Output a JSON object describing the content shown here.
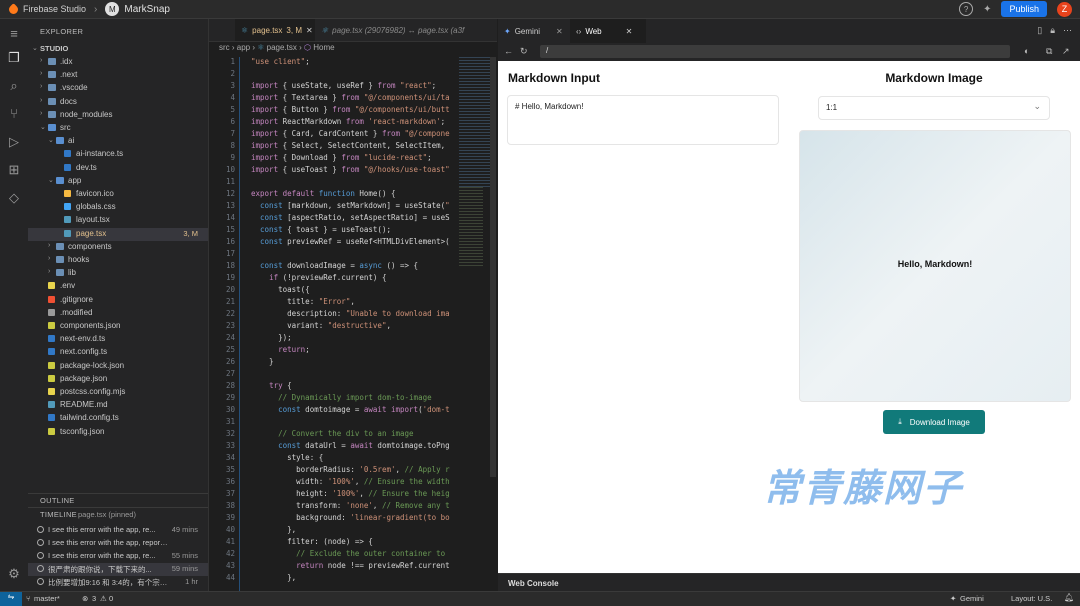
{
  "topbar": {
    "brand": "Firebase Studio",
    "project_initial": "M",
    "project": "MarkSnap",
    "publish": "Publish",
    "avatar": "Z"
  },
  "explorer": {
    "title": "EXPLORER",
    "root": "STUDIO",
    "items": [
      {
        "label": ".idx",
        "type": "folder",
        "depth": 1
      },
      {
        "label": ".next",
        "type": "folder",
        "depth": 1
      },
      {
        "label": ".vscode",
        "type": "folder",
        "depth": 1
      },
      {
        "label": "docs",
        "type": "folder",
        "depth": 1
      },
      {
        "label": "node_modules",
        "type": "folder",
        "depth": 1
      },
      {
        "label": "src",
        "type": "folder-open",
        "depth": 1
      },
      {
        "label": "ai",
        "type": "folder-open",
        "depth": 2
      },
      {
        "label": "ai-instance.ts",
        "type": "ts",
        "depth": 3
      },
      {
        "label": "dev.ts",
        "type": "ts",
        "depth": 3
      },
      {
        "label": "app",
        "type": "folder-open",
        "depth": 2
      },
      {
        "label": "favicon.ico",
        "type": "ico",
        "depth": 3
      },
      {
        "label": "globals.css",
        "type": "css",
        "depth": 3
      },
      {
        "label": "layout.tsx",
        "type": "tsx",
        "depth": 3
      },
      {
        "label": "page.tsx",
        "type": "tsx",
        "depth": 3,
        "badge": "3, M",
        "selected": true
      },
      {
        "label": "components",
        "type": "folder",
        "depth": 2
      },
      {
        "label": "hooks",
        "type": "folder",
        "depth": 2
      },
      {
        "label": "lib",
        "type": "folder",
        "depth": 2
      },
      {
        "label": ".env",
        "type": "env",
        "depth": 1
      },
      {
        "label": ".gitignore",
        "type": "git",
        "depth": 1
      },
      {
        "label": ".modified",
        "type": "file",
        "depth": 1
      },
      {
        "label": "components.json",
        "type": "json",
        "depth": 1
      },
      {
        "label": "next-env.d.ts",
        "type": "ts",
        "depth": 1
      },
      {
        "label": "next.config.ts",
        "type": "ts",
        "depth": 1
      },
      {
        "label": "package-lock.json",
        "type": "json",
        "depth": 1
      },
      {
        "label": "package.json",
        "type": "json",
        "depth": 1
      },
      {
        "label": "postcss.config.mjs",
        "type": "js",
        "depth": 1
      },
      {
        "label": "README.md",
        "type": "md",
        "depth": 1
      },
      {
        "label": "tailwind.config.ts",
        "type": "ts",
        "depth": 1
      },
      {
        "label": "tsconfig.json",
        "type": "json",
        "depth": 1
      }
    ],
    "outline": "OUTLINE",
    "timeline": "TIMELINE",
    "timeline_file": "page.tsx (pinned)",
    "timeline_items": [
      {
        "text": "I see this error with the app, re...",
        "time": "49 mins"
      },
      {
        "text": "I see this error with the app, reported...",
        "time": ""
      },
      {
        "text": "I see this error with the app, re...",
        "time": "55 mins"
      },
      {
        "text": "很严肃的跟你说，下载下来的...",
        "time": "59 mins"
      },
      {
        "text": "比例要增加9:16 和 3:4的，有个宗旨...",
        "time": "1 hr"
      }
    ]
  },
  "editor": {
    "tab_active": "page.tsx",
    "tab_active_badge": "3, M",
    "tab_other": "page.tsx (29076982) ↔ page.tsx (a3f",
    "breadcrumb": [
      "src",
      "app",
      "page.tsx",
      "Home"
    ],
    "lines": [
      "\"use client\";",
      "",
      "import { useState, useRef } from \"react\";",
      "import { Textarea } from \"@/components/ui/ta",
      "import { Button } from \"@/components/ui/butt",
      "import ReactMarkdown from 'react-markdown';",
      "import { Card, CardContent } from \"@/compone",
      "import { Select, SelectContent, SelectItem,",
      "import { Download } from \"lucide-react\";",
      "import { useToast } from \"@/hooks/use-toast\"",
      "",
      "export default function Home() {",
      "  const [markdown, setMarkdown] = useState(\"",
      "  const [aspectRatio, setAspectRatio] = useS",
      "  const { toast } = useToast();",
      "  const previewRef = useRef<HTMLDivElement>(",
      "",
      "  const downloadImage = async () => {",
      "    if (!previewRef.current) {",
      "      toast({",
      "        title: \"Error\",",
      "        description: \"Unable to download ima",
      "        variant: \"destructive\",",
      "      });",
      "      return;",
      "    }",
      "",
      "    try {",
      "      // Dynamically import dom-to-image",
      "      const domtoimage = await import('dom-t",
      "",
      "      // Convert the div to an image",
      "      const dataUrl = await domtoimage.toPng",
      "        style: {",
      "          borderRadius: '0.5rem', // Apply r",
      "          width: '100%', // Ensure the width",
      "          height: '100%', // Ensure the heig",
      "          transform: 'none', // Remove any t",
      "          background: 'linear-gradient(to bo",
      "        },",
      "        filter: (node) => {",
      "          // Exclude the outer container to",
      "          return node !== previewRef.current",
      "        },"
    ]
  },
  "preview": {
    "tab_gemini": "Gemini",
    "tab_web": "Web",
    "url": "/",
    "app": {
      "input_title": "Markdown Input",
      "input_value": "# Hello, Markdown!",
      "image_title": "Markdown Image",
      "ratio": "1:1",
      "rendered": "Hello, Markdown!",
      "download": "Download Image",
      "watermark": "常青藤网子"
    },
    "console": "Web Console"
  },
  "statusbar": {
    "branch": "master*",
    "problems": "3",
    "warnings": "0",
    "gemini": "Gemini",
    "layout": "Layout: U.S."
  },
  "colors": {
    "accent": "#1a73e8",
    "teal_button": "#117a7a",
    "badge_modified": "#e2c08d"
  }
}
